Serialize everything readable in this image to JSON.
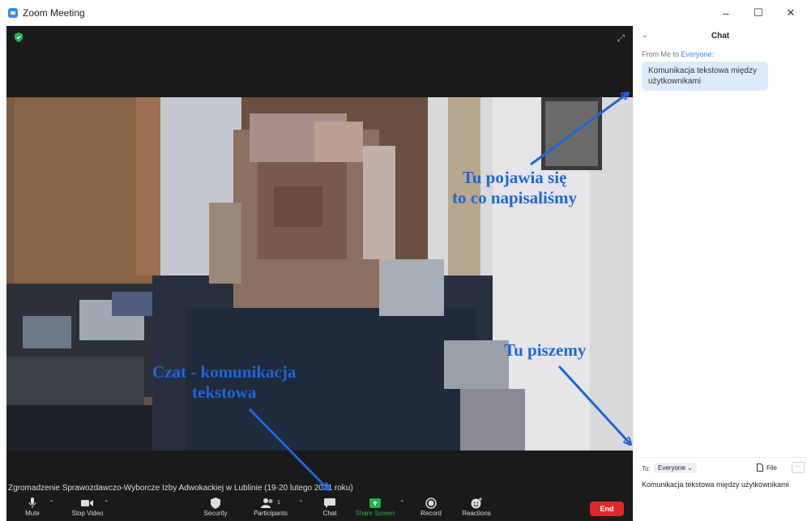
{
  "window": {
    "title": "Zoom Meeting",
    "minimize": "–",
    "maximize": "☐",
    "close": "✕"
  },
  "meeting": {
    "topic": "Zgromadzenie Sprawozdawczo-Wyborcze Izby Adwokackiej w Lublinie (19-20 lutego 2021 roku)"
  },
  "toolbar": {
    "mute": "Mute",
    "stop_video": "Stop Video",
    "security": "Security",
    "participants": "Participants",
    "participants_count": "1",
    "chat": "Chat",
    "share_screen": "Share Screen",
    "record": "Record",
    "reactions": "Reactions",
    "end": "End"
  },
  "chat": {
    "title": "Chat",
    "from_prefix": "From Me to ",
    "from_recipient": "Everyone",
    "from_suffix": ":",
    "message": "Komunikacja tekstowa między użytkownikami",
    "to_label": "To:",
    "to_value": "Everyone",
    "file_label": "File",
    "more": "···",
    "input_value": "Komunikacja tekstowa między użytkownikami"
  },
  "annotations": {
    "top_right_line1": "Tu pojawia się",
    "top_right_line2": "to co napisaliśmy",
    "bottom_right": "Tu piszemy",
    "bottom_left_line1": "Czat - komunikacja",
    "bottom_left_line2": "tekstowa"
  },
  "colors": {
    "accent": "#2d8cff",
    "annotation": "#1e66d8",
    "end": "#e02828",
    "share": "#23b04a"
  }
}
